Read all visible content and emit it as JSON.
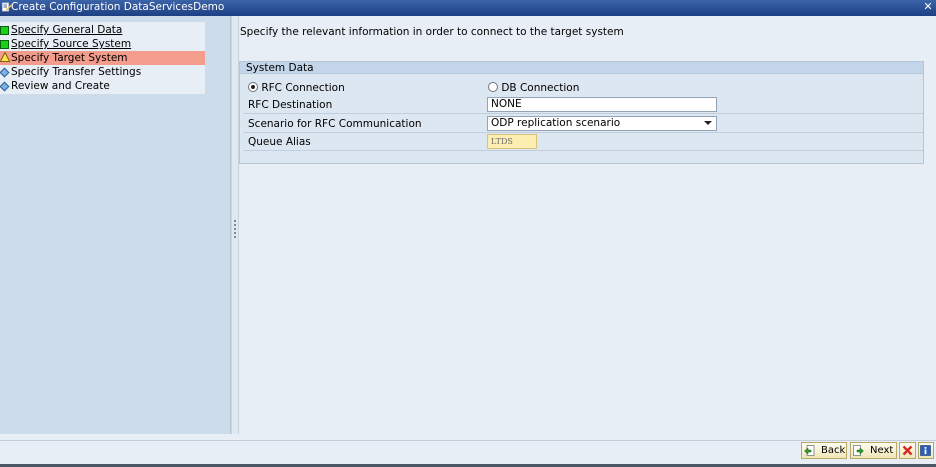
{
  "window": {
    "title": "Create Configuration DataServicesDemo"
  },
  "steps": [
    {
      "label": "Specify General Data",
      "status": "complete",
      "icon": "green-square-icon"
    },
    {
      "label": "Specify Source System",
      "status": "complete",
      "icon": "green-square-icon"
    },
    {
      "label": "Specify Target System",
      "status": "current",
      "icon": "warning-icon"
    },
    {
      "label": "Specify Transfer Settings",
      "status": "pending",
      "icon": "diamond-icon"
    },
    {
      "label": "Review and Create",
      "status": "pending",
      "icon": "diamond-icon"
    }
  ],
  "main": {
    "instruction": "Specify the relevant information in order to connect to the target system",
    "group_title": "System Data",
    "connection_type": {
      "options": [
        "RFC Connection",
        "DB Connection"
      ],
      "selected": "RFC Connection"
    },
    "fields": {
      "rfc_destination": {
        "label": "RFC Destination",
        "value": "NONE"
      },
      "scenario": {
        "label": "Scenario for RFC Communication",
        "value": "ODP replication scenario"
      },
      "queue_alias": {
        "label": "Queue Alias",
        "value": "LTDS"
      }
    }
  },
  "footer": {
    "back_label": "Back",
    "next_label": "Next"
  },
  "colors": {
    "title_bar": "#1d3f84",
    "active_step": "#f59d8c",
    "complete": "#1ad11a",
    "readonly_field": "#fceeb0"
  }
}
